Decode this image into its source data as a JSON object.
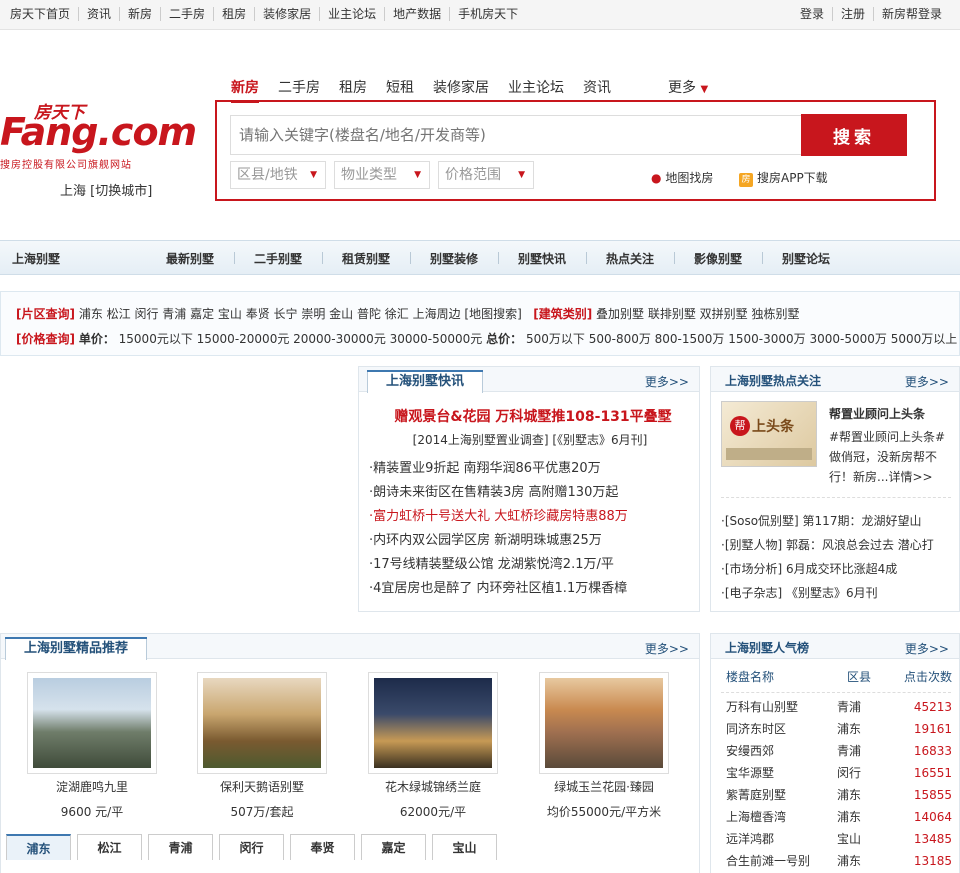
{
  "topbar": {
    "links": [
      "房天下首页",
      "资讯",
      "新房",
      "二手房",
      "租房",
      "装修家居",
      "业主论坛",
      "地产数据",
      "手机房天下"
    ],
    "right": [
      "登录",
      "注册",
      "新房帮登录"
    ]
  },
  "logo": {
    "cn": "房天下",
    "en": "Fang.com",
    "sub": "搜房控股有限公司旗舰网站"
  },
  "city": "上海 [切换城市]",
  "search": {
    "tabs": [
      "新房",
      "二手房",
      "租房",
      "短租",
      "装修家居",
      "业主论坛",
      "资讯"
    ],
    "more": "更多",
    "placeholder": "请输入关键字(楼盘名/地名/开发商等)",
    "button": "搜索",
    "selects": [
      "区县/地铁",
      "物业类型",
      "价格范围"
    ],
    "map_link": "地图找房",
    "app_link": "搜房APP下载",
    "app_icon": "房"
  },
  "channel": {
    "title": "上海别墅",
    "items": [
      "最新别墅",
      "二手别墅",
      "租赁别墅",
      "别墅装修",
      "别墅快讯",
      "热点关注",
      "影像别墅",
      "别墅论坛"
    ]
  },
  "filter": {
    "area_label": "[片区查询]",
    "areas": "浦东 松江 闵行 青浦 嘉定 宝山 奉贤 长宁 崇明 金山 普陀 徐汇 上海周边 [地图搜索]",
    "type_label": "[建筑类别]",
    "types": "叠加别墅 联排别墅 双拼别墅 独栋别墅",
    "price_label": "[价格查询]",
    "unit_label": "单价：",
    "unit_prices": "15000元以下 15000-20000元 20000-30000元 30000-50000元",
    "total_label": "总价：",
    "total_prices": "500万以下 500-800万 800-1500万 1500-3000万 3000-5000万 5000万以上"
  },
  "news": {
    "title": "上海别墅快讯",
    "more": "更多>>",
    "headline": "赠观景台&花园 万科城墅推108-131平叠墅",
    "sub": "[2014上海别墅置业调查] [《别墅志》6月刊]",
    "items": [
      {
        "text": "·精装置业9折起 南翔华润86平优惠20万",
        "red": false
      },
      {
        "text": "·朗诗未来街区在售精装3房 高附赠130万起",
        "red": false
      },
      {
        "text": "·富力虹桥十号送大礼 大虹桥珍藏房特惠88万",
        "red": true
      },
      {
        "text": "·内环内双公园学区房 新湖明珠城惠25万",
        "red": false
      },
      {
        "text": "·17号线精装墅级公馆 龙湖紫悦湾2.1万/平",
        "red": false
      },
      {
        "text": "·4宜居房也是醉了 内环旁社区植1.1万棵香樟",
        "red": false
      }
    ]
  },
  "hot": {
    "title": "上海别墅热点关注",
    "more": "更多>>",
    "img_badge": "帮",
    "img_text": "上头条",
    "feature_title": "帮置业顾问上头条",
    "feature_desc": "#帮置业顾问上头条#做俏冠，没新房帮不行！新房...详情>>",
    "items": [
      "·[Soso侃别墅] 第117期：龙湖好望山",
      "·[别墅人物] 郭磊：风浪总会过去 潜心打",
      "·[市场分析] 6月成交环比涨超4成",
      "·[电子杂志] 《别墅志》6月刊"
    ]
  },
  "premium": {
    "title": "上海别墅精品推荐",
    "more": "更多>>",
    "cards": [
      {
        "name": "淀湖鹿鸣九里",
        "price": "9600 元/平"
      },
      {
        "name": "保利天鹅语别墅",
        "price": "507万/套起"
      },
      {
        "name": "花木绿城锦绣兰庭",
        "price": "62000元/平"
      },
      {
        "name": "绿城玉兰花园·臻园",
        "price": "均价55000元/平方米"
      }
    ],
    "district_tabs": [
      "浦东",
      "松江",
      "青浦",
      "闵行",
      "奉贤",
      "嘉定",
      "宝山"
    ]
  },
  "rank": {
    "title": "上海别墅人气榜",
    "more": "更多>>",
    "headers": [
      "楼盘名称",
      "区县",
      "点击次数"
    ],
    "rows": [
      [
        "万科有山别墅",
        "青浦",
        "45213"
      ],
      [
        "同济东时区",
        "浦东",
        "19161"
      ],
      [
        "安缦西郊",
        "青浦",
        "16833"
      ],
      [
        "宝华源墅",
        "闵行",
        "16551"
      ],
      [
        "紫菁庭别墅",
        "浦东",
        "15855"
      ],
      [
        "上海檀香湾",
        "浦东",
        "14064"
      ],
      [
        "远洋鸿郡",
        "宝山",
        "13485"
      ],
      [
        "合生前滩一号别",
        "浦东",
        "13185"
      ]
    ]
  },
  "colors": {
    "brand": "#c8161d",
    "link_blue": "#24517a"
  }
}
